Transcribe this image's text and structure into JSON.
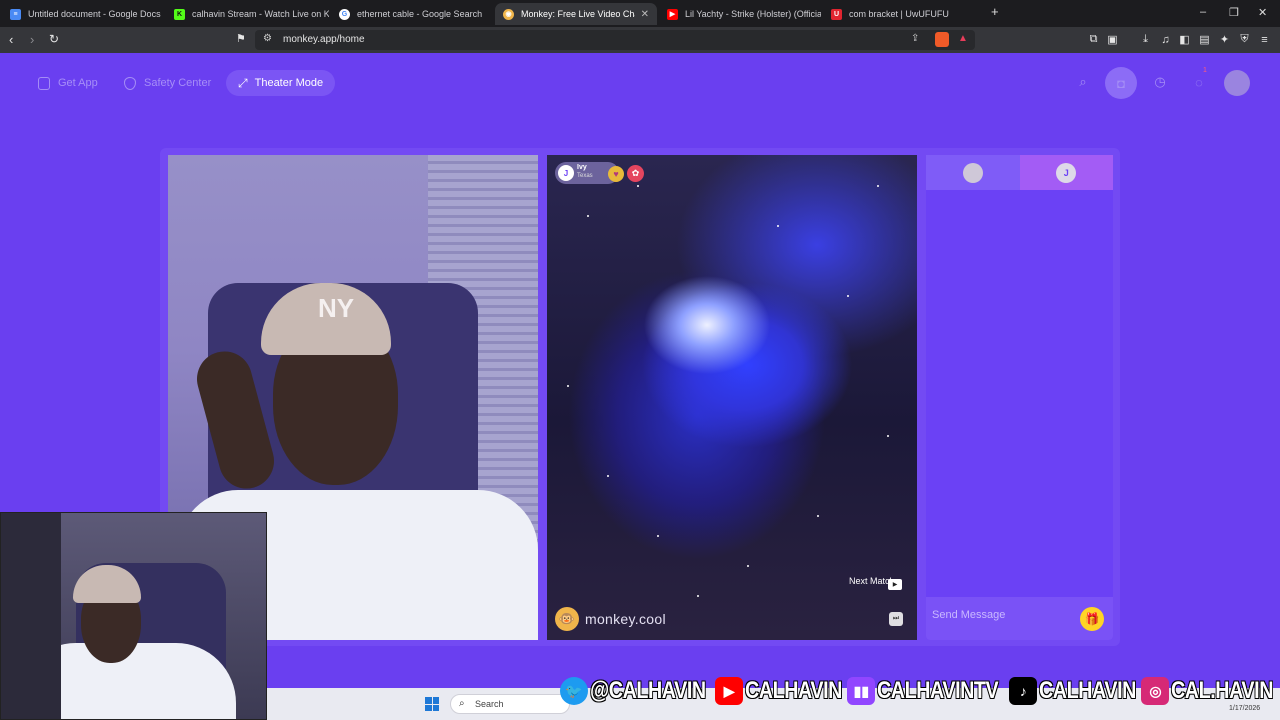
{
  "browser": {
    "tabs": [
      {
        "title": "Untitled document - Google Docs",
        "icon": "docs-icon",
        "color": "#4a8af4"
      },
      {
        "title": "calhavin Stream - Watch Live on Kick",
        "icon": "kick-icon",
        "color": "#53fc18"
      },
      {
        "title": "ethernet cable - Google Search",
        "icon": "google-icon",
        "color": "#ffffff"
      },
      {
        "title": "Monkey: Free Live Video Chat",
        "icon": "monkey-icon",
        "color": "#f0b54b"
      },
      {
        "title": "Lil Yachty - Strike (Holster) (Official M",
        "icon": "youtube-icon",
        "color": "#ff0000"
      },
      {
        "title": "com bracket | UwUFUFU",
        "icon": "uwufufu-icon",
        "color": "#e0242f"
      }
    ],
    "new_tab": "+",
    "url": "monkey.app/home"
  },
  "page": {
    "nav": {
      "get_app": "Get App",
      "safety_center": "Safety Center",
      "theater_mode": "Theater Mode"
    },
    "notification_count": "1",
    "peer": {
      "initial": "J",
      "name": "Ivy",
      "location": "Texas"
    },
    "next_match": "Next Match",
    "watermark": "monkey.cool",
    "chat": {
      "tab_initial": "J",
      "placeholder": "Send Message"
    }
  },
  "taskbar": {
    "search": "Search",
    "date": "1/17/2026"
  },
  "socials": [
    {
      "platform": "twitter",
      "handle": "@CALHAVIN",
      "color": "#1d9bf0"
    },
    {
      "platform": "youtube",
      "handle": "CALHAVIN",
      "color": "#ff0000"
    },
    {
      "platform": "twitch",
      "handle": "CALHAVINTV",
      "color": "#9146ff"
    },
    {
      "platform": "tiktok",
      "handle": "CALHAVIN",
      "color": "#000000"
    },
    {
      "platform": "instagram",
      "handle": "CAL.HAVIN",
      "color": "#d62976"
    }
  ],
  "colors": {
    "page_bg": "#6a3ff0",
    "accent": "#7b55f4",
    "gift": "#ffd425"
  }
}
